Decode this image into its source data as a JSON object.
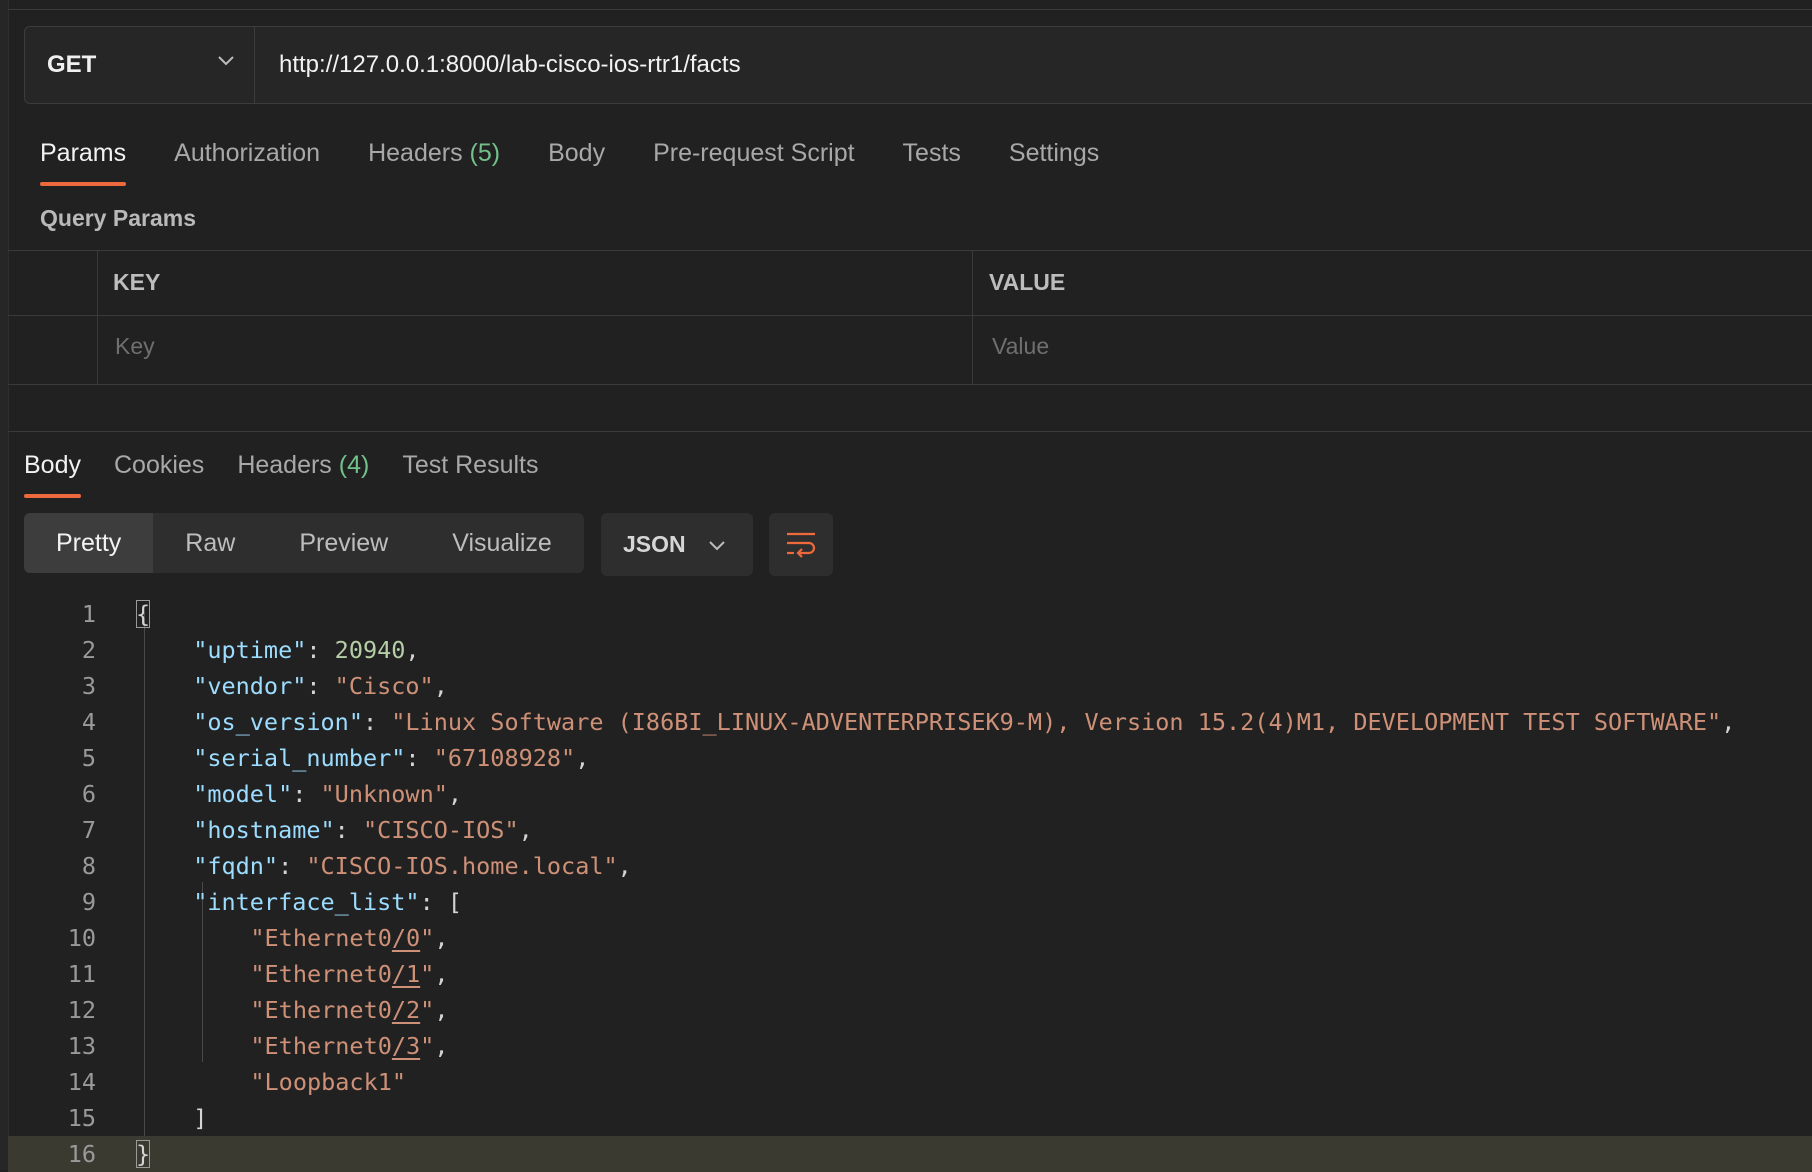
{
  "request": {
    "method": "GET",
    "url": "http://127.0.0.1:8000/lab-cisco-ios-rtr1/facts"
  },
  "request_tabs": [
    {
      "label": "Params",
      "active": true
    },
    {
      "label": "Authorization"
    },
    {
      "label": "Headers",
      "count": "(5)"
    },
    {
      "label": "Body"
    },
    {
      "label": "Pre-request Script"
    },
    {
      "label": "Tests"
    },
    {
      "label": "Settings"
    }
  ],
  "query_params": {
    "title": "Query Params",
    "key_header": "KEY",
    "value_header": "VALUE",
    "key_placeholder": "Key",
    "value_placeholder": "Value"
  },
  "response_tabs": [
    {
      "label": "Body",
      "active": true
    },
    {
      "label": "Cookies"
    },
    {
      "label": "Headers",
      "count": "(4)"
    },
    {
      "label": "Test Results"
    }
  ],
  "view_modes": [
    "Pretty",
    "Raw",
    "Preview",
    "Visualize"
  ],
  "active_view": "Pretty",
  "format": "JSON",
  "colors": {
    "accent": "#ee6a3c",
    "count": "#73c08b",
    "key": "#9cdcfe",
    "string": "#ce9178",
    "number": "#b5cea8"
  },
  "response_body": [
    {
      "n": "1",
      "parts": [
        [
          "p",
          "{"
        ]
      ]
    },
    {
      "n": "2",
      "parts": [
        [
          "k",
          "\"uptime\""
        ],
        [
          "p",
          ": "
        ],
        [
          "n",
          "20940"
        ],
        [
          "p",
          ","
        ]
      ]
    },
    {
      "n": "3",
      "parts": [
        [
          "k",
          "\"vendor\""
        ],
        [
          "p",
          ": "
        ],
        [
          "s",
          "\"Cisco\""
        ],
        [
          "p",
          ","
        ]
      ]
    },
    {
      "n": "4",
      "parts": [
        [
          "k",
          "\"os_version\""
        ],
        [
          "p",
          ": "
        ],
        [
          "s",
          "\"Linux Software (I86BI_LINUX-ADVENTERPRISEK9-M), Version 15.2(4)M1, DEVELOPMENT TEST SOFTWARE\""
        ],
        [
          "p",
          ","
        ]
      ]
    },
    {
      "n": "5",
      "parts": [
        [
          "k",
          "\"serial_number\""
        ],
        [
          "p",
          ": "
        ],
        [
          "s",
          "\"67108928\""
        ],
        [
          "p",
          ","
        ]
      ]
    },
    {
      "n": "6",
      "parts": [
        [
          "k",
          "\"model\""
        ],
        [
          "p",
          ": "
        ],
        [
          "s",
          "\"Unknown\""
        ],
        [
          "p",
          ","
        ]
      ]
    },
    {
      "n": "7",
      "parts": [
        [
          "k",
          "\"hostname\""
        ],
        [
          "p",
          ": "
        ],
        [
          "s",
          "\"CISCO-IOS\""
        ],
        [
          "p",
          ","
        ]
      ]
    },
    {
      "n": "8",
      "parts": [
        [
          "k",
          "\"fqdn\""
        ],
        [
          "p",
          ": "
        ],
        [
          "s",
          "\"CISCO-IOS.home.local\""
        ],
        [
          "p",
          ","
        ]
      ]
    },
    {
      "n": "9",
      "parts": [
        [
          "k",
          "\"interface_list\""
        ],
        [
          "p",
          ": ["
        ]
      ]
    },
    {
      "n": "10",
      "parts": [
        [
          "s",
          "\"Ethernet0"
        ],
        [
          "su",
          "/0"
        ],
        [
          "s",
          "\""
        ],
        [
          "p",
          ","
        ]
      ]
    },
    {
      "n": "11",
      "parts": [
        [
          "s",
          "\"Ethernet0"
        ],
        [
          "su",
          "/1"
        ],
        [
          "s",
          "\""
        ],
        [
          "p",
          ","
        ]
      ]
    },
    {
      "n": "12",
      "parts": [
        [
          "s",
          "\"Ethernet0"
        ],
        [
          "su",
          "/2"
        ],
        [
          "s",
          "\""
        ],
        [
          "p",
          ","
        ]
      ]
    },
    {
      "n": "13",
      "parts": [
        [
          "s",
          "\"Ethernet0"
        ],
        [
          "su",
          "/3"
        ],
        [
          "s",
          "\""
        ],
        [
          "p",
          ","
        ]
      ]
    },
    {
      "n": "14",
      "parts": [
        [
          "s",
          "\"Loopback1\""
        ]
      ]
    },
    {
      "n": "15",
      "parts": [
        [
          "p",
          "]"
        ]
      ]
    },
    {
      "n": "16",
      "parts": [
        [
          "p",
          "}"
        ]
      ]
    }
  ]
}
